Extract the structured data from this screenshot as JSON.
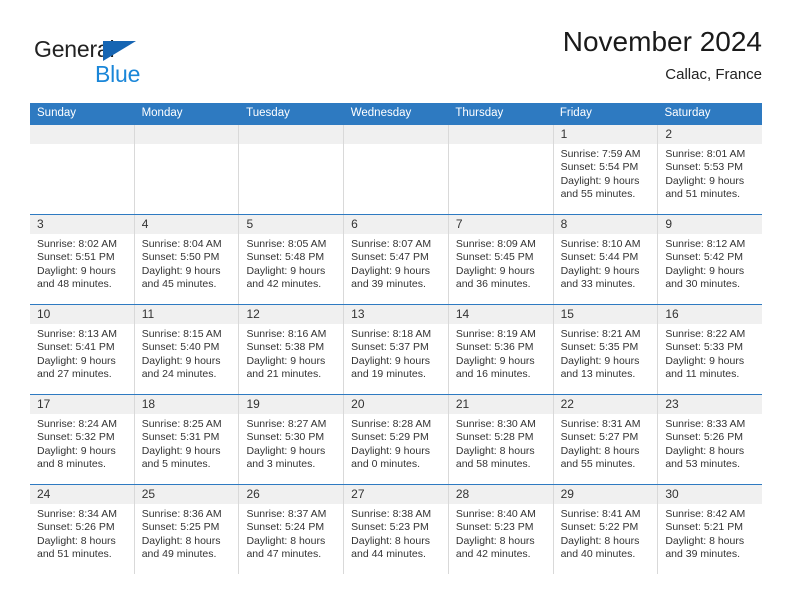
{
  "brand": {
    "general": "General",
    "blue": "Blue",
    "triangle_color": "#1665b3",
    "blue_color": "#1a86d8"
  },
  "header": {
    "month_title": "November 2024",
    "location": "Callac, France"
  },
  "theme": {
    "header_row_bg": "#2e7ac1",
    "daynum_bg": "#f0f0f0",
    "cell_border": "#d9d9d9"
  },
  "weekdays": [
    "Sunday",
    "Monday",
    "Tuesday",
    "Wednesday",
    "Thursday",
    "Friday",
    "Saturday"
  ],
  "weeks": [
    [
      {
        "day": "",
        "sunrise": "",
        "sunset": "",
        "daylight_line1": "",
        "daylight_line2": ""
      },
      {
        "day": "",
        "sunrise": "",
        "sunset": "",
        "daylight_line1": "",
        "daylight_line2": ""
      },
      {
        "day": "",
        "sunrise": "",
        "sunset": "",
        "daylight_line1": "",
        "daylight_line2": ""
      },
      {
        "day": "",
        "sunrise": "",
        "sunset": "",
        "daylight_line1": "",
        "daylight_line2": ""
      },
      {
        "day": "",
        "sunrise": "",
        "sunset": "",
        "daylight_line1": "",
        "daylight_line2": ""
      },
      {
        "day": "1",
        "sunrise": "Sunrise: 7:59 AM",
        "sunset": "Sunset: 5:54 PM",
        "daylight_line1": "Daylight: 9 hours",
        "daylight_line2": "and 55 minutes."
      },
      {
        "day": "2",
        "sunrise": "Sunrise: 8:01 AM",
        "sunset": "Sunset: 5:53 PM",
        "daylight_line1": "Daylight: 9 hours",
        "daylight_line2": "and 51 minutes."
      }
    ],
    [
      {
        "day": "3",
        "sunrise": "Sunrise: 8:02 AM",
        "sunset": "Sunset: 5:51 PM",
        "daylight_line1": "Daylight: 9 hours",
        "daylight_line2": "and 48 minutes."
      },
      {
        "day": "4",
        "sunrise": "Sunrise: 8:04 AM",
        "sunset": "Sunset: 5:50 PM",
        "daylight_line1": "Daylight: 9 hours",
        "daylight_line2": "and 45 minutes."
      },
      {
        "day": "5",
        "sunrise": "Sunrise: 8:05 AM",
        "sunset": "Sunset: 5:48 PM",
        "daylight_line1": "Daylight: 9 hours",
        "daylight_line2": "and 42 minutes."
      },
      {
        "day": "6",
        "sunrise": "Sunrise: 8:07 AM",
        "sunset": "Sunset: 5:47 PM",
        "daylight_line1": "Daylight: 9 hours",
        "daylight_line2": "and 39 minutes."
      },
      {
        "day": "7",
        "sunrise": "Sunrise: 8:09 AM",
        "sunset": "Sunset: 5:45 PM",
        "daylight_line1": "Daylight: 9 hours",
        "daylight_line2": "and 36 minutes."
      },
      {
        "day": "8",
        "sunrise": "Sunrise: 8:10 AM",
        "sunset": "Sunset: 5:44 PM",
        "daylight_line1": "Daylight: 9 hours",
        "daylight_line2": "and 33 minutes."
      },
      {
        "day": "9",
        "sunrise": "Sunrise: 8:12 AM",
        "sunset": "Sunset: 5:42 PM",
        "daylight_line1": "Daylight: 9 hours",
        "daylight_line2": "and 30 minutes."
      }
    ],
    [
      {
        "day": "10",
        "sunrise": "Sunrise: 8:13 AM",
        "sunset": "Sunset: 5:41 PM",
        "daylight_line1": "Daylight: 9 hours",
        "daylight_line2": "and 27 minutes."
      },
      {
        "day": "11",
        "sunrise": "Sunrise: 8:15 AM",
        "sunset": "Sunset: 5:40 PM",
        "daylight_line1": "Daylight: 9 hours",
        "daylight_line2": "and 24 minutes."
      },
      {
        "day": "12",
        "sunrise": "Sunrise: 8:16 AM",
        "sunset": "Sunset: 5:38 PM",
        "daylight_line1": "Daylight: 9 hours",
        "daylight_line2": "and 21 minutes."
      },
      {
        "day": "13",
        "sunrise": "Sunrise: 8:18 AM",
        "sunset": "Sunset: 5:37 PM",
        "daylight_line1": "Daylight: 9 hours",
        "daylight_line2": "and 19 minutes."
      },
      {
        "day": "14",
        "sunrise": "Sunrise: 8:19 AM",
        "sunset": "Sunset: 5:36 PM",
        "daylight_line1": "Daylight: 9 hours",
        "daylight_line2": "and 16 minutes."
      },
      {
        "day": "15",
        "sunrise": "Sunrise: 8:21 AM",
        "sunset": "Sunset: 5:35 PM",
        "daylight_line1": "Daylight: 9 hours",
        "daylight_line2": "and 13 minutes."
      },
      {
        "day": "16",
        "sunrise": "Sunrise: 8:22 AM",
        "sunset": "Sunset: 5:33 PM",
        "daylight_line1": "Daylight: 9 hours",
        "daylight_line2": "and 11 minutes."
      }
    ],
    [
      {
        "day": "17",
        "sunrise": "Sunrise: 8:24 AM",
        "sunset": "Sunset: 5:32 PM",
        "daylight_line1": "Daylight: 9 hours",
        "daylight_line2": "and 8 minutes."
      },
      {
        "day": "18",
        "sunrise": "Sunrise: 8:25 AM",
        "sunset": "Sunset: 5:31 PM",
        "daylight_line1": "Daylight: 9 hours",
        "daylight_line2": "and 5 minutes."
      },
      {
        "day": "19",
        "sunrise": "Sunrise: 8:27 AM",
        "sunset": "Sunset: 5:30 PM",
        "daylight_line1": "Daylight: 9 hours",
        "daylight_line2": "and 3 minutes."
      },
      {
        "day": "20",
        "sunrise": "Sunrise: 8:28 AM",
        "sunset": "Sunset: 5:29 PM",
        "daylight_line1": "Daylight: 9 hours",
        "daylight_line2": "and 0 minutes."
      },
      {
        "day": "21",
        "sunrise": "Sunrise: 8:30 AM",
        "sunset": "Sunset: 5:28 PM",
        "daylight_line1": "Daylight: 8 hours",
        "daylight_line2": "and 58 minutes."
      },
      {
        "day": "22",
        "sunrise": "Sunrise: 8:31 AM",
        "sunset": "Sunset: 5:27 PM",
        "daylight_line1": "Daylight: 8 hours",
        "daylight_line2": "and 55 minutes."
      },
      {
        "day": "23",
        "sunrise": "Sunrise: 8:33 AM",
        "sunset": "Sunset: 5:26 PM",
        "daylight_line1": "Daylight: 8 hours",
        "daylight_line2": "and 53 minutes."
      }
    ],
    [
      {
        "day": "24",
        "sunrise": "Sunrise: 8:34 AM",
        "sunset": "Sunset: 5:26 PM",
        "daylight_line1": "Daylight: 8 hours",
        "daylight_line2": "and 51 minutes."
      },
      {
        "day": "25",
        "sunrise": "Sunrise: 8:36 AM",
        "sunset": "Sunset: 5:25 PM",
        "daylight_line1": "Daylight: 8 hours",
        "daylight_line2": "and 49 minutes."
      },
      {
        "day": "26",
        "sunrise": "Sunrise: 8:37 AM",
        "sunset": "Sunset: 5:24 PM",
        "daylight_line1": "Daylight: 8 hours",
        "daylight_line2": "and 47 minutes."
      },
      {
        "day": "27",
        "sunrise": "Sunrise: 8:38 AM",
        "sunset": "Sunset: 5:23 PM",
        "daylight_line1": "Daylight: 8 hours",
        "daylight_line2": "and 44 minutes."
      },
      {
        "day": "28",
        "sunrise": "Sunrise: 8:40 AM",
        "sunset": "Sunset: 5:23 PM",
        "daylight_line1": "Daylight: 8 hours",
        "daylight_line2": "and 42 minutes."
      },
      {
        "day": "29",
        "sunrise": "Sunrise: 8:41 AM",
        "sunset": "Sunset: 5:22 PM",
        "daylight_line1": "Daylight: 8 hours",
        "daylight_line2": "and 40 minutes."
      },
      {
        "day": "30",
        "sunrise": "Sunrise: 8:42 AM",
        "sunset": "Sunset: 5:21 PM",
        "daylight_line1": "Daylight: 8 hours",
        "daylight_line2": "and 39 minutes."
      }
    ]
  ]
}
